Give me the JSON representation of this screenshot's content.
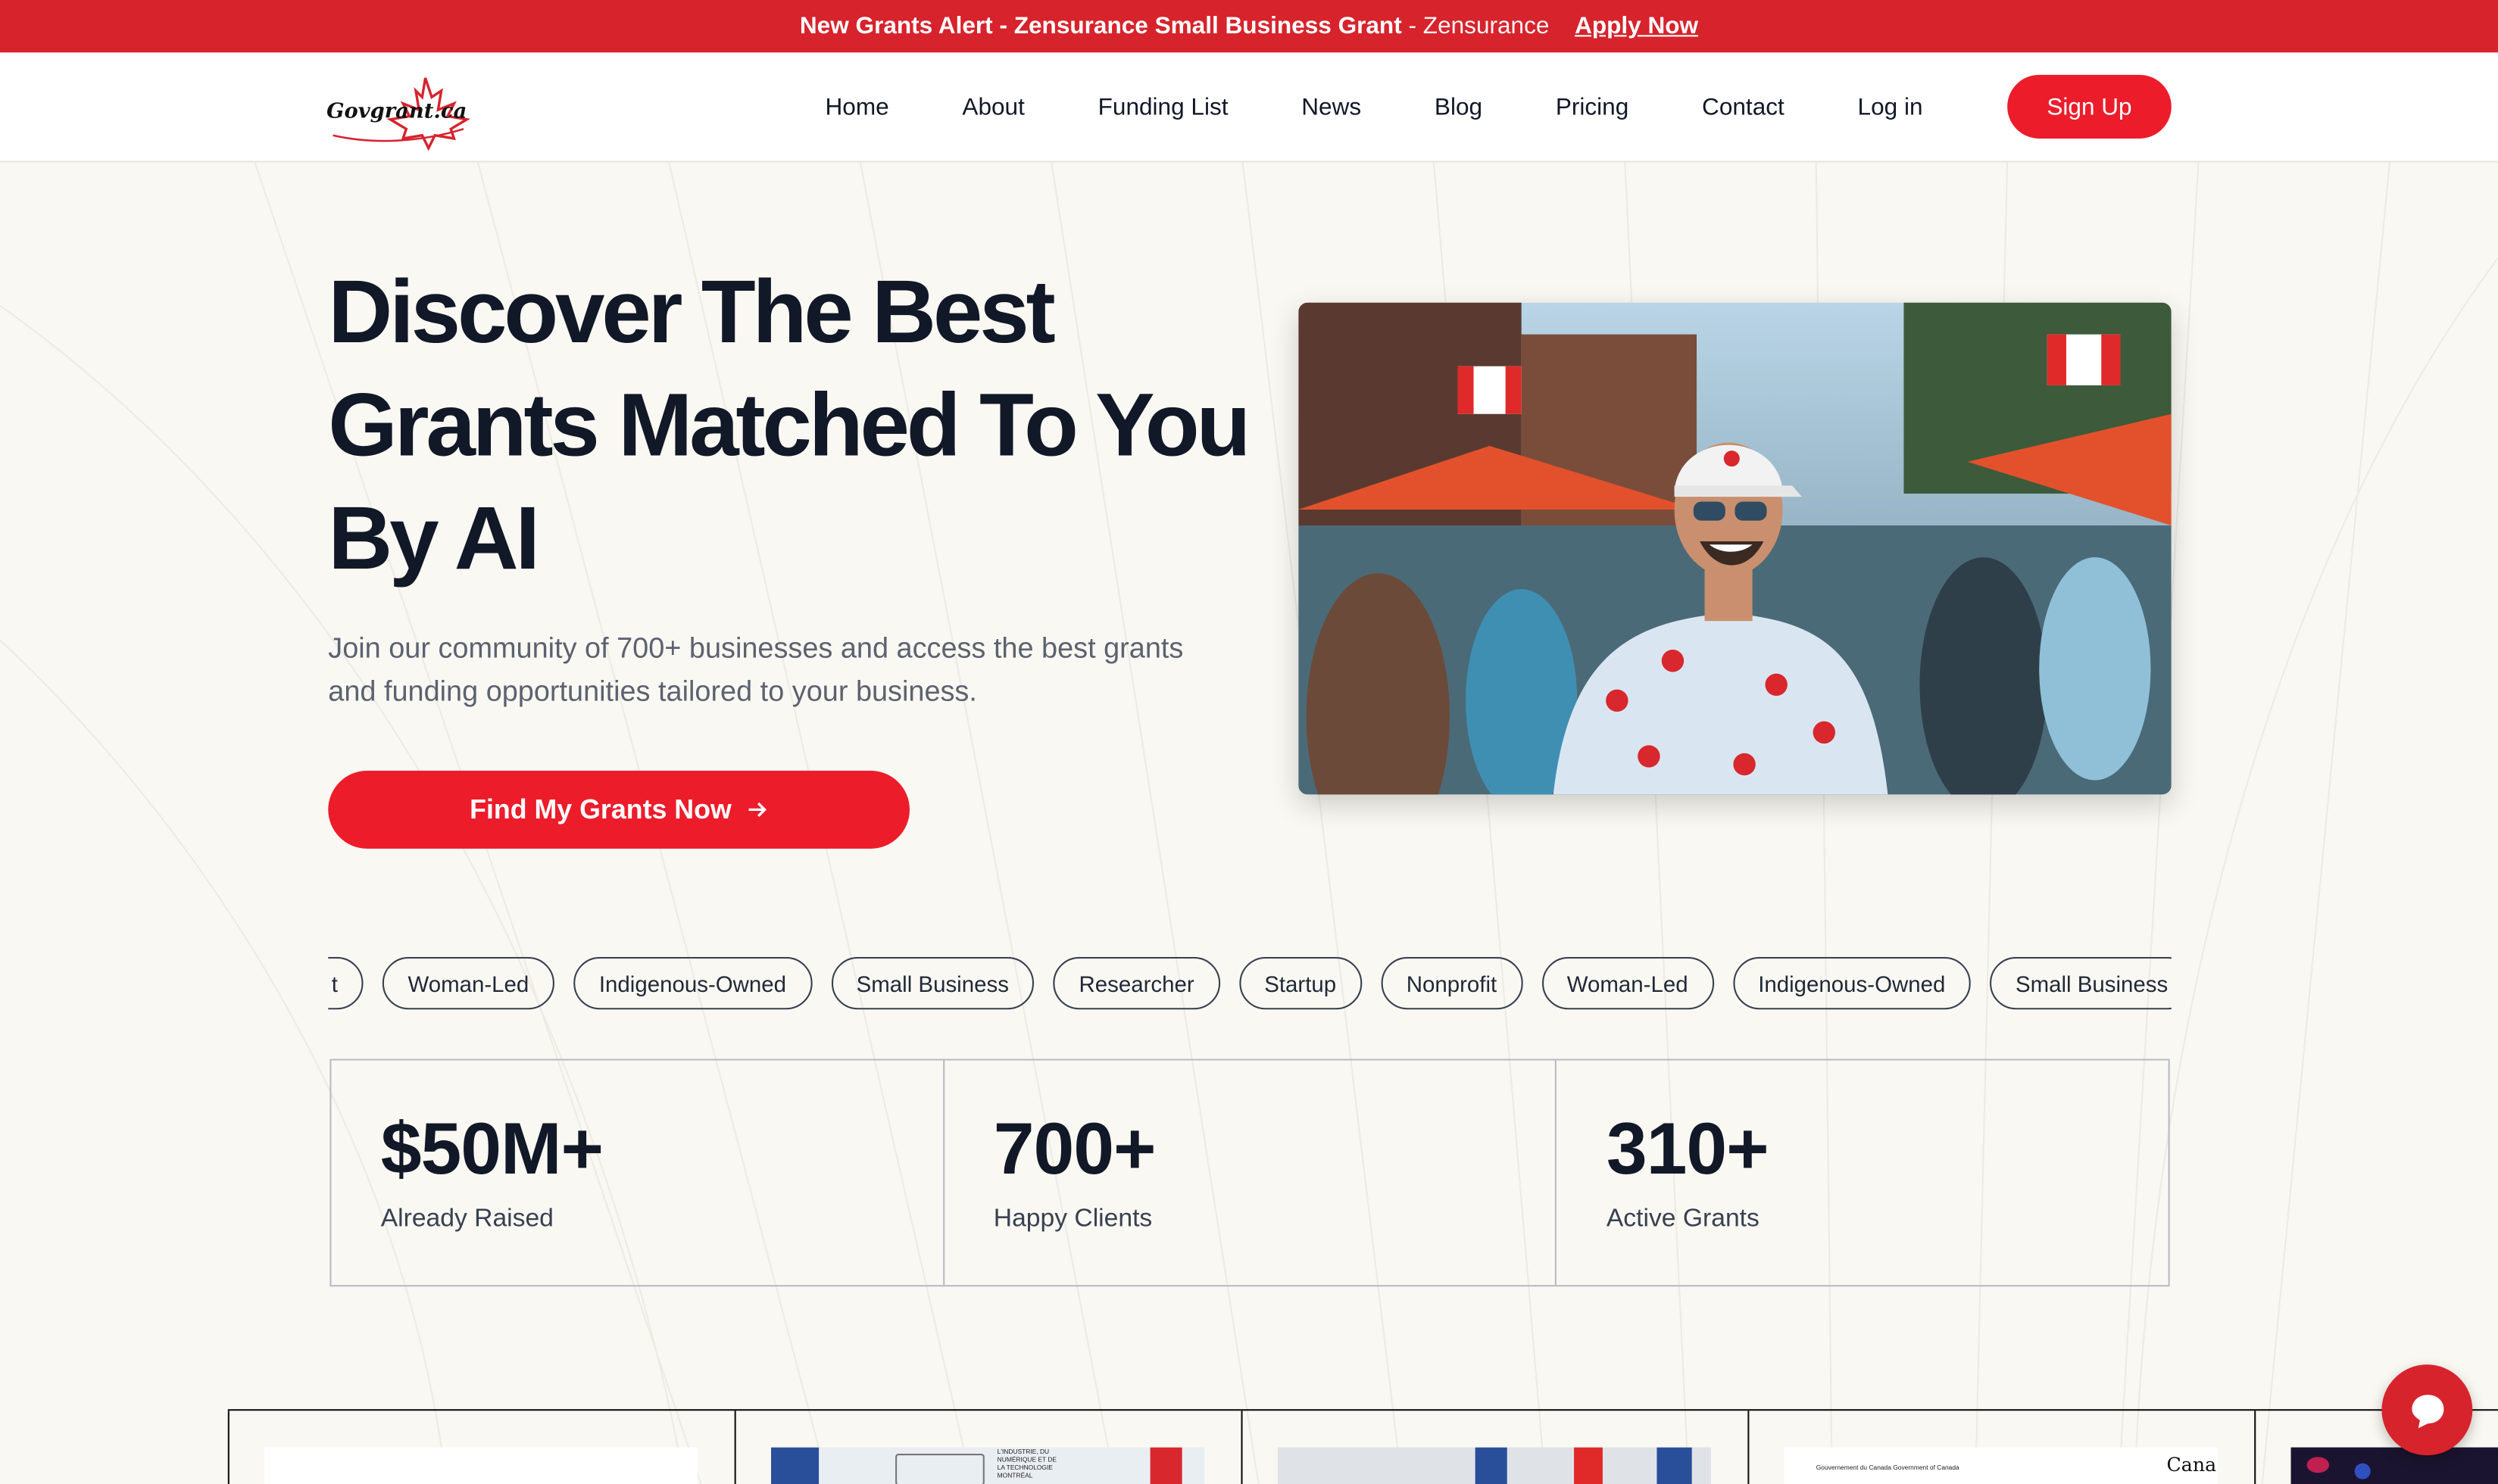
{
  "alert_bar": {
    "headline": "New Grants Alert - Zensurance Small Business Grant",
    "separator": "-",
    "source": "Zensurance",
    "link_label": "Apply Now"
  },
  "nav": {
    "logo_text": "Govgrant.ca",
    "links": [
      "Home",
      "About",
      "Funding List",
      "News",
      "Blog",
      "Pricing",
      "Contact",
      "Log in"
    ],
    "signup_label": "Sign Up"
  },
  "hero": {
    "title_lines": [
      "Discover The Best",
      "Grants Matched To You",
      "By AI"
    ],
    "subtitle_lines": [
      "Join our community of 700+ businesses and access the best grants",
      "and funding opportunities tailored to your business."
    ],
    "cta_label": "Find My Grants Now",
    "cta_icon": "arrow-right-icon"
  },
  "tags": [
    "t",
    "Woman-Led",
    "Indigenous-Owned",
    "Small Business",
    "Researcher",
    "Startup",
    "Nonprofit",
    "Woman-Led",
    "Indigenous-Owned",
    "Small Business"
  ],
  "tags_partial_first_visible": "t",
  "stats": [
    {
      "value": "$50M+",
      "label": "Already Raised"
    },
    {
      "value": "700+",
      "label": "Happy Clients"
    },
    {
      "value": "310+",
      "label": "Active Grants"
    }
  ],
  "news_thumbs": {
    "card2_caption": "L'INDUSTRIE, DU NUMÉRIQUE ET DE LA TECHNOLOGIE MONTRÉAL",
    "card4_caption": "Gouvernement du Canada  Government of Canada",
    "card4_wordmark": "Cana"
  },
  "colors": {
    "brand_red": "#ec1c2b",
    "alert_red": "#d7232c",
    "background": "#faf8f2",
    "text_dark": "#111827"
  },
  "chat_icon": "chat-bubble-icon"
}
